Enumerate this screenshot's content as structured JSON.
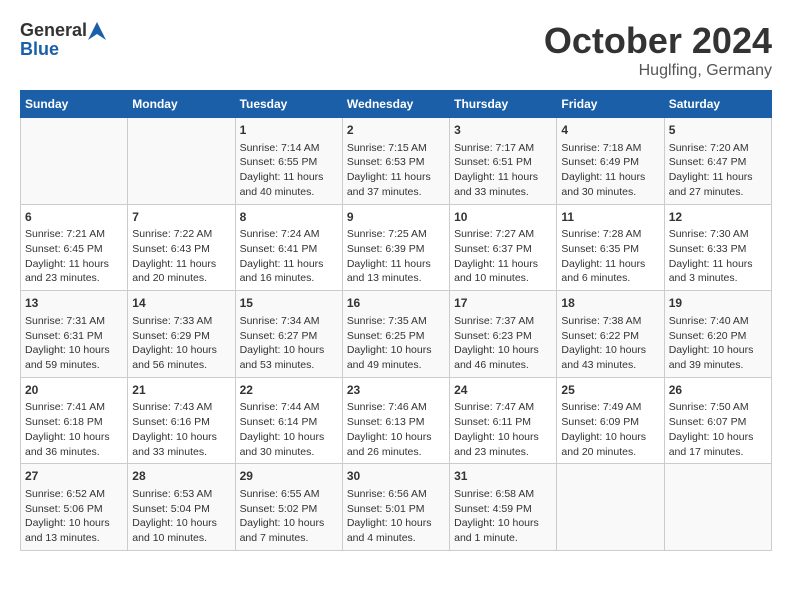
{
  "header": {
    "logo_general": "General",
    "logo_blue": "Blue",
    "month_year": "October 2024",
    "location": "Huglfing, Germany"
  },
  "days_of_week": [
    "Sunday",
    "Monday",
    "Tuesday",
    "Wednesday",
    "Thursday",
    "Friday",
    "Saturday"
  ],
  "weeks": [
    [
      {
        "day": "",
        "content": ""
      },
      {
        "day": "",
        "content": ""
      },
      {
        "day": "1",
        "content": "Sunrise: 7:14 AM\nSunset: 6:55 PM\nDaylight: 11 hours and 40 minutes."
      },
      {
        "day": "2",
        "content": "Sunrise: 7:15 AM\nSunset: 6:53 PM\nDaylight: 11 hours and 37 minutes."
      },
      {
        "day": "3",
        "content": "Sunrise: 7:17 AM\nSunset: 6:51 PM\nDaylight: 11 hours and 33 minutes."
      },
      {
        "day": "4",
        "content": "Sunrise: 7:18 AM\nSunset: 6:49 PM\nDaylight: 11 hours and 30 minutes."
      },
      {
        "day": "5",
        "content": "Sunrise: 7:20 AM\nSunset: 6:47 PM\nDaylight: 11 hours and 27 minutes."
      }
    ],
    [
      {
        "day": "6",
        "content": "Sunrise: 7:21 AM\nSunset: 6:45 PM\nDaylight: 11 hours and 23 minutes."
      },
      {
        "day": "7",
        "content": "Sunrise: 7:22 AM\nSunset: 6:43 PM\nDaylight: 11 hours and 20 minutes."
      },
      {
        "day": "8",
        "content": "Sunrise: 7:24 AM\nSunset: 6:41 PM\nDaylight: 11 hours and 16 minutes."
      },
      {
        "day": "9",
        "content": "Sunrise: 7:25 AM\nSunset: 6:39 PM\nDaylight: 11 hours and 13 minutes."
      },
      {
        "day": "10",
        "content": "Sunrise: 7:27 AM\nSunset: 6:37 PM\nDaylight: 11 hours and 10 minutes."
      },
      {
        "day": "11",
        "content": "Sunrise: 7:28 AM\nSunset: 6:35 PM\nDaylight: 11 hours and 6 minutes."
      },
      {
        "day": "12",
        "content": "Sunrise: 7:30 AM\nSunset: 6:33 PM\nDaylight: 11 hours and 3 minutes."
      }
    ],
    [
      {
        "day": "13",
        "content": "Sunrise: 7:31 AM\nSunset: 6:31 PM\nDaylight: 10 hours and 59 minutes."
      },
      {
        "day": "14",
        "content": "Sunrise: 7:33 AM\nSunset: 6:29 PM\nDaylight: 10 hours and 56 minutes."
      },
      {
        "day": "15",
        "content": "Sunrise: 7:34 AM\nSunset: 6:27 PM\nDaylight: 10 hours and 53 minutes."
      },
      {
        "day": "16",
        "content": "Sunrise: 7:35 AM\nSunset: 6:25 PM\nDaylight: 10 hours and 49 minutes."
      },
      {
        "day": "17",
        "content": "Sunrise: 7:37 AM\nSunset: 6:23 PM\nDaylight: 10 hours and 46 minutes."
      },
      {
        "day": "18",
        "content": "Sunrise: 7:38 AM\nSunset: 6:22 PM\nDaylight: 10 hours and 43 minutes."
      },
      {
        "day": "19",
        "content": "Sunrise: 7:40 AM\nSunset: 6:20 PM\nDaylight: 10 hours and 39 minutes."
      }
    ],
    [
      {
        "day": "20",
        "content": "Sunrise: 7:41 AM\nSunset: 6:18 PM\nDaylight: 10 hours and 36 minutes."
      },
      {
        "day": "21",
        "content": "Sunrise: 7:43 AM\nSunset: 6:16 PM\nDaylight: 10 hours and 33 minutes."
      },
      {
        "day": "22",
        "content": "Sunrise: 7:44 AM\nSunset: 6:14 PM\nDaylight: 10 hours and 30 minutes."
      },
      {
        "day": "23",
        "content": "Sunrise: 7:46 AM\nSunset: 6:13 PM\nDaylight: 10 hours and 26 minutes."
      },
      {
        "day": "24",
        "content": "Sunrise: 7:47 AM\nSunset: 6:11 PM\nDaylight: 10 hours and 23 minutes."
      },
      {
        "day": "25",
        "content": "Sunrise: 7:49 AM\nSunset: 6:09 PM\nDaylight: 10 hours and 20 minutes."
      },
      {
        "day": "26",
        "content": "Sunrise: 7:50 AM\nSunset: 6:07 PM\nDaylight: 10 hours and 17 minutes."
      }
    ],
    [
      {
        "day": "27",
        "content": "Sunrise: 6:52 AM\nSunset: 5:06 PM\nDaylight: 10 hours and 13 minutes."
      },
      {
        "day": "28",
        "content": "Sunrise: 6:53 AM\nSunset: 5:04 PM\nDaylight: 10 hours and 10 minutes."
      },
      {
        "day": "29",
        "content": "Sunrise: 6:55 AM\nSunset: 5:02 PM\nDaylight: 10 hours and 7 minutes."
      },
      {
        "day": "30",
        "content": "Sunrise: 6:56 AM\nSunset: 5:01 PM\nDaylight: 10 hours and 4 minutes."
      },
      {
        "day": "31",
        "content": "Sunrise: 6:58 AM\nSunset: 4:59 PM\nDaylight: 10 hours and 1 minute."
      },
      {
        "day": "",
        "content": ""
      },
      {
        "day": "",
        "content": ""
      }
    ]
  ]
}
